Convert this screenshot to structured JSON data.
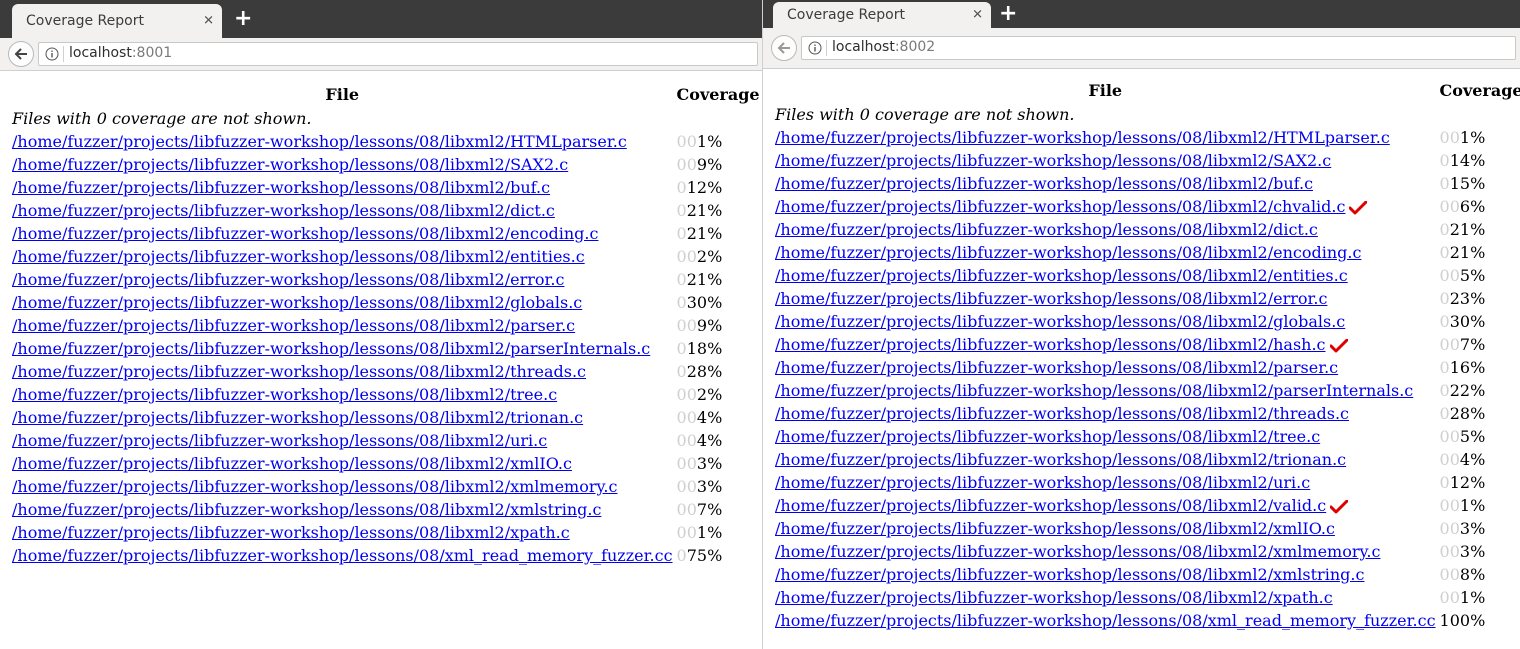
{
  "accent": "#0000ee",
  "check_color": "#e00000",
  "windows": [
    {
      "tab_title": "Coverage Report",
      "tab_close": "✕",
      "new_tab": "+",
      "url_host": "localhost",
      "url_port": ":8001",
      "header_file": "File",
      "header_coverage": "Coverage",
      "note": "Files with 0 coverage are not shown.",
      "rows": [
        {
          "file": "/home/fuzzer/projects/libfuzzer-workshop/lessons/08/libxml2/HTMLparser.c",
          "pad": "00",
          "pct": "1%",
          "check": false
        },
        {
          "file": "/home/fuzzer/projects/libfuzzer-workshop/lessons/08/libxml2/SAX2.c",
          "pad": "00",
          "pct": "9%",
          "check": false
        },
        {
          "file": "/home/fuzzer/projects/libfuzzer-workshop/lessons/08/libxml2/buf.c",
          "pad": "0",
          "pct": "12%",
          "check": false
        },
        {
          "file": "/home/fuzzer/projects/libfuzzer-workshop/lessons/08/libxml2/dict.c",
          "pad": "0",
          "pct": "21%",
          "check": false
        },
        {
          "file": "/home/fuzzer/projects/libfuzzer-workshop/lessons/08/libxml2/encoding.c",
          "pad": "0",
          "pct": "21%",
          "check": false
        },
        {
          "file": "/home/fuzzer/projects/libfuzzer-workshop/lessons/08/libxml2/entities.c",
          "pad": "00",
          "pct": "2%",
          "check": false
        },
        {
          "file": "/home/fuzzer/projects/libfuzzer-workshop/lessons/08/libxml2/error.c",
          "pad": "0",
          "pct": "21%",
          "check": false
        },
        {
          "file": "/home/fuzzer/projects/libfuzzer-workshop/lessons/08/libxml2/globals.c",
          "pad": "0",
          "pct": "30%",
          "check": false
        },
        {
          "file": "/home/fuzzer/projects/libfuzzer-workshop/lessons/08/libxml2/parser.c",
          "pad": "00",
          "pct": "9%",
          "check": false
        },
        {
          "file": "/home/fuzzer/projects/libfuzzer-workshop/lessons/08/libxml2/parserInternals.c",
          "pad": "0",
          "pct": "18%",
          "check": false
        },
        {
          "file": "/home/fuzzer/projects/libfuzzer-workshop/lessons/08/libxml2/threads.c",
          "pad": "0",
          "pct": "28%",
          "check": false
        },
        {
          "file": "/home/fuzzer/projects/libfuzzer-workshop/lessons/08/libxml2/tree.c",
          "pad": "00",
          "pct": "2%",
          "check": false
        },
        {
          "file": "/home/fuzzer/projects/libfuzzer-workshop/lessons/08/libxml2/trionan.c",
          "pad": "00",
          "pct": "4%",
          "check": false
        },
        {
          "file": "/home/fuzzer/projects/libfuzzer-workshop/lessons/08/libxml2/uri.c",
          "pad": "00",
          "pct": "4%",
          "check": false
        },
        {
          "file": "/home/fuzzer/projects/libfuzzer-workshop/lessons/08/libxml2/xmlIO.c",
          "pad": "00",
          "pct": "3%",
          "check": false
        },
        {
          "file": "/home/fuzzer/projects/libfuzzer-workshop/lessons/08/libxml2/xmlmemory.c",
          "pad": "00",
          "pct": "3%",
          "check": false
        },
        {
          "file": "/home/fuzzer/projects/libfuzzer-workshop/lessons/08/libxml2/xmlstring.c",
          "pad": "00",
          "pct": "7%",
          "check": false
        },
        {
          "file": "/home/fuzzer/projects/libfuzzer-workshop/lessons/08/libxml2/xpath.c",
          "pad": "00",
          "pct": "1%",
          "check": false
        },
        {
          "file": "/home/fuzzer/projects/libfuzzer-workshop/lessons/08/xml_read_memory_fuzzer.cc",
          "pad": "0",
          "pct": "75%",
          "check": false
        }
      ]
    },
    {
      "tab_title": "Coverage Report",
      "tab_close": "✕",
      "new_tab": "+",
      "url_host": "localhost",
      "url_port": ":8002",
      "header_file": "File",
      "header_coverage": "Coverage",
      "note": "Files with 0 coverage are not shown.",
      "rows": [
        {
          "file": "/home/fuzzer/projects/libfuzzer-workshop/lessons/08/libxml2/HTMLparser.c",
          "pad": "00",
          "pct": "1%",
          "check": false
        },
        {
          "file": "/home/fuzzer/projects/libfuzzer-workshop/lessons/08/libxml2/SAX2.c",
          "pad": "0",
          "pct": "14%",
          "check": false
        },
        {
          "file": "/home/fuzzer/projects/libfuzzer-workshop/lessons/08/libxml2/buf.c",
          "pad": "0",
          "pct": "15%",
          "check": false
        },
        {
          "file": "/home/fuzzer/projects/libfuzzer-workshop/lessons/08/libxml2/chvalid.c",
          "pad": "00",
          "pct": "6%",
          "check": true
        },
        {
          "file": "/home/fuzzer/projects/libfuzzer-workshop/lessons/08/libxml2/dict.c",
          "pad": "0",
          "pct": "21%",
          "check": false
        },
        {
          "file": "/home/fuzzer/projects/libfuzzer-workshop/lessons/08/libxml2/encoding.c",
          "pad": "0",
          "pct": "21%",
          "check": false
        },
        {
          "file": "/home/fuzzer/projects/libfuzzer-workshop/lessons/08/libxml2/entities.c",
          "pad": "00",
          "pct": "5%",
          "check": false
        },
        {
          "file": "/home/fuzzer/projects/libfuzzer-workshop/lessons/08/libxml2/error.c",
          "pad": "0",
          "pct": "23%",
          "check": false
        },
        {
          "file": "/home/fuzzer/projects/libfuzzer-workshop/lessons/08/libxml2/globals.c",
          "pad": "0",
          "pct": "30%",
          "check": false
        },
        {
          "file": "/home/fuzzer/projects/libfuzzer-workshop/lessons/08/libxml2/hash.c",
          "pad": "00",
          "pct": "7%",
          "check": true
        },
        {
          "file": "/home/fuzzer/projects/libfuzzer-workshop/lessons/08/libxml2/parser.c",
          "pad": "0",
          "pct": "16%",
          "check": false
        },
        {
          "file": "/home/fuzzer/projects/libfuzzer-workshop/lessons/08/libxml2/parserInternals.c",
          "pad": "0",
          "pct": "22%",
          "check": false
        },
        {
          "file": "/home/fuzzer/projects/libfuzzer-workshop/lessons/08/libxml2/threads.c",
          "pad": "0",
          "pct": "28%",
          "check": false
        },
        {
          "file": "/home/fuzzer/projects/libfuzzer-workshop/lessons/08/libxml2/tree.c",
          "pad": "00",
          "pct": "5%",
          "check": false
        },
        {
          "file": "/home/fuzzer/projects/libfuzzer-workshop/lessons/08/libxml2/trionan.c",
          "pad": "00",
          "pct": "4%",
          "check": false
        },
        {
          "file": "/home/fuzzer/projects/libfuzzer-workshop/lessons/08/libxml2/uri.c",
          "pad": "0",
          "pct": "12%",
          "check": false
        },
        {
          "file": "/home/fuzzer/projects/libfuzzer-workshop/lessons/08/libxml2/valid.c",
          "pad": "00",
          "pct": "1%",
          "check": true
        },
        {
          "file": "/home/fuzzer/projects/libfuzzer-workshop/lessons/08/libxml2/xmlIO.c",
          "pad": "00",
          "pct": "3%",
          "check": false
        },
        {
          "file": "/home/fuzzer/projects/libfuzzer-workshop/lessons/08/libxml2/xmlmemory.c",
          "pad": "00",
          "pct": "3%",
          "check": false
        },
        {
          "file": "/home/fuzzer/projects/libfuzzer-workshop/lessons/08/libxml2/xmlstring.c",
          "pad": "00",
          "pct": "8%",
          "check": false
        },
        {
          "file": "/home/fuzzer/projects/libfuzzer-workshop/lessons/08/libxml2/xpath.c",
          "pad": "00",
          "pct": "1%",
          "check": false
        },
        {
          "file": "/home/fuzzer/projects/libfuzzer-workshop/lessons/08/xml_read_memory_fuzzer.cc",
          "pad": "",
          "pct": "100%",
          "check": false
        }
      ]
    }
  ]
}
